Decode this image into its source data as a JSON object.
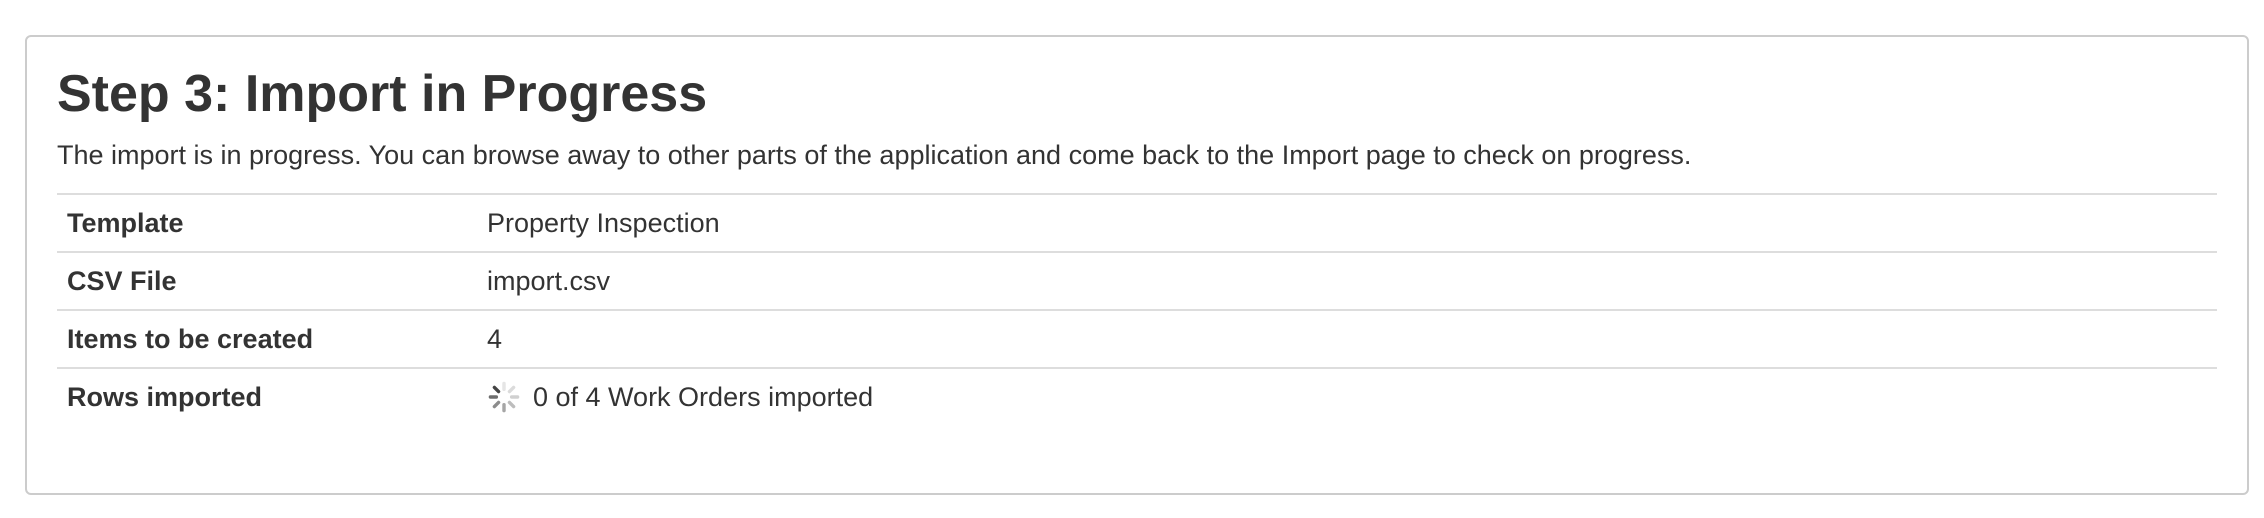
{
  "panel": {
    "title": "Step 3: Import in Progress",
    "description": "The import is in progress. You can browse away to other parts of the application and come back to the Import page to check on progress."
  },
  "details": {
    "rows": [
      {
        "label": "Template",
        "value": "Property Inspection"
      },
      {
        "label": "CSV File",
        "value": "import.csv"
      },
      {
        "label": "Items to be created",
        "value": "4"
      },
      {
        "label": "Rows imported",
        "value": "0 of 4 Work Orders imported",
        "icon": "loading-spinner-icon"
      }
    ]
  },
  "colors": {
    "border": "#cccccc",
    "row_divider": "#dddddd",
    "text": "#333333"
  }
}
